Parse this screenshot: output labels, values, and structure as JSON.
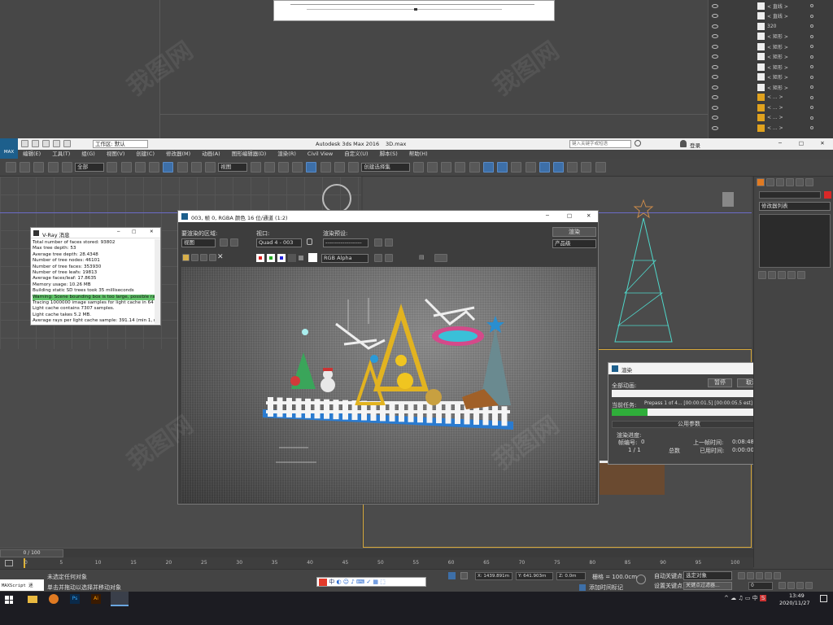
{
  "layers": [
    {
      "label": "< 直线 >",
      "swatch": "white"
    },
    {
      "label": "< 直线 >",
      "swatch": "white"
    },
    {
      "label": "320",
      "swatch": "white"
    },
    {
      "label": "< 矩形 >",
      "swatch": "white"
    },
    {
      "label": "< 矩形 >",
      "swatch": "white"
    },
    {
      "label": "< 矩形 >",
      "swatch": "white"
    },
    {
      "label": "< 矩形 >",
      "swatch": "white"
    },
    {
      "label": "< 矩形 >",
      "swatch": "white"
    },
    {
      "label": "< 矩形 >",
      "swatch": "white"
    },
    {
      "label": "< ... >",
      "swatch": "yellow"
    },
    {
      "label": "< ... >",
      "swatch": "yellow"
    },
    {
      "label": "< ... >",
      "swatch": "yellow"
    },
    {
      "label": "< ... >",
      "swatch": "yellow"
    }
  ],
  "titlebar": {
    "workspace": "工作区: 默认",
    "title": "Autodesk 3ds Max 2016",
    "file": "3D.max",
    "search_placeholder": "键入关键字或短语",
    "login": "登录",
    "logo": "MAX"
  },
  "menu": [
    "编辑(E)",
    "工具(T)",
    "组(G)",
    "视图(V)",
    "创建(C)",
    "修改器(M)",
    "动画(A)",
    "图形编辑器(D)",
    "渲染(R)",
    "Civil View",
    "自定义(U)",
    "脚本(S)",
    "帮助(H)"
  ],
  "toolbar": {
    "filter": "全部",
    "ref": "视图",
    "selset": "创建选择集"
  },
  "vray": {
    "title": "V-Ray 消息",
    "lines": [
      "Total number of faces stored: 93802",
      "Max tree depth: 53",
      "Average tree depth: 28.4348",
      "Number of tree nodes: 46101",
      "Number of tree faces: 353930",
      "Number of tree leafs: 19813",
      "Average faces/leaf: 17.8635",
      "Memory usage: 10.26 MB",
      "Building static SD trees took 35 milliseconds"
    ],
    "warning": "Warning: Scene bounding box is too large, possible raycast e",
    "lines2": [
      "Tracing 1000000 image samples for light cache in 64 passes",
      "Light cache contains 7307 samples.",
      "Light cache takes 5.2 MB.",
      "Average rays per light cache sample: 391.14 (min 1, max 31"
    ]
  },
  "frame": {
    "title": "003, 帧 0, RGBA 颜色 16 位/通道 (1:2)",
    "area_label": "要渲染的区域:",
    "area_value": "视图",
    "viewport_label": "视口:",
    "viewport_value": "Quad 4 - 003",
    "preset_label": "渲染预设:",
    "preset_value": "-------------------",
    "render_button": "渲染",
    "product_value": "产品级",
    "channel_value": "RGB Alpha"
  },
  "render": {
    "title": "渲染",
    "total_label": "全部动画:",
    "pause": "暂停",
    "cancel": "取消",
    "task_label": "当前任务:",
    "task_value": "Prepass 1 of 4... [00:00:01.5] [00:00:05.5 est]",
    "progress": 0.23,
    "section": "公用参数",
    "render_progress": "渲染进度:",
    "frame_label": "帧编号:",
    "frame_value": "0",
    "count": "1 / 1",
    "total_word": "总数",
    "last_frame": "上一帧时间:",
    "last_frame_value": "0:08:48",
    "elapsed": "已用时间:",
    "elapsed_value": "0:00:00"
  },
  "cmdpanel": {
    "modifier_list": "修改器列表"
  },
  "timeline": {
    "frame": "0 / 100",
    "ticks": [
      "0",
      "5",
      "10",
      "15",
      "20",
      "25",
      "30",
      "35",
      "40",
      "45",
      "50",
      "55",
      "60",
      "65",
      "70",
      "75",
      "80",
      "85",
      "90",
      "95",
      "100"
    ]
  },
  "status": {
    "maxscript": "MAXScript 迷",
    "sel": "未选定任何对象",
    "hint": "单击并拖动以选择并移动对象",
    "x": "X: 1439.891m",
    "y": "Y: 641.903m",
    "z": "Z: 0.0m",
    "grid": "栅格 = 100.0cm",
    "autokey": "自动关键点",
    "setkey": "设置关键点",
    "selobj": "选定对象",
    "keyfilter": "关键点过滤器...",
    "addtime": "添加时间标记",
    "frame_field": "0"
  },
  "taskbar": {
    "time": "13:49",
    "date": "2020/11/27",
    "ime": "中"
  }
}
